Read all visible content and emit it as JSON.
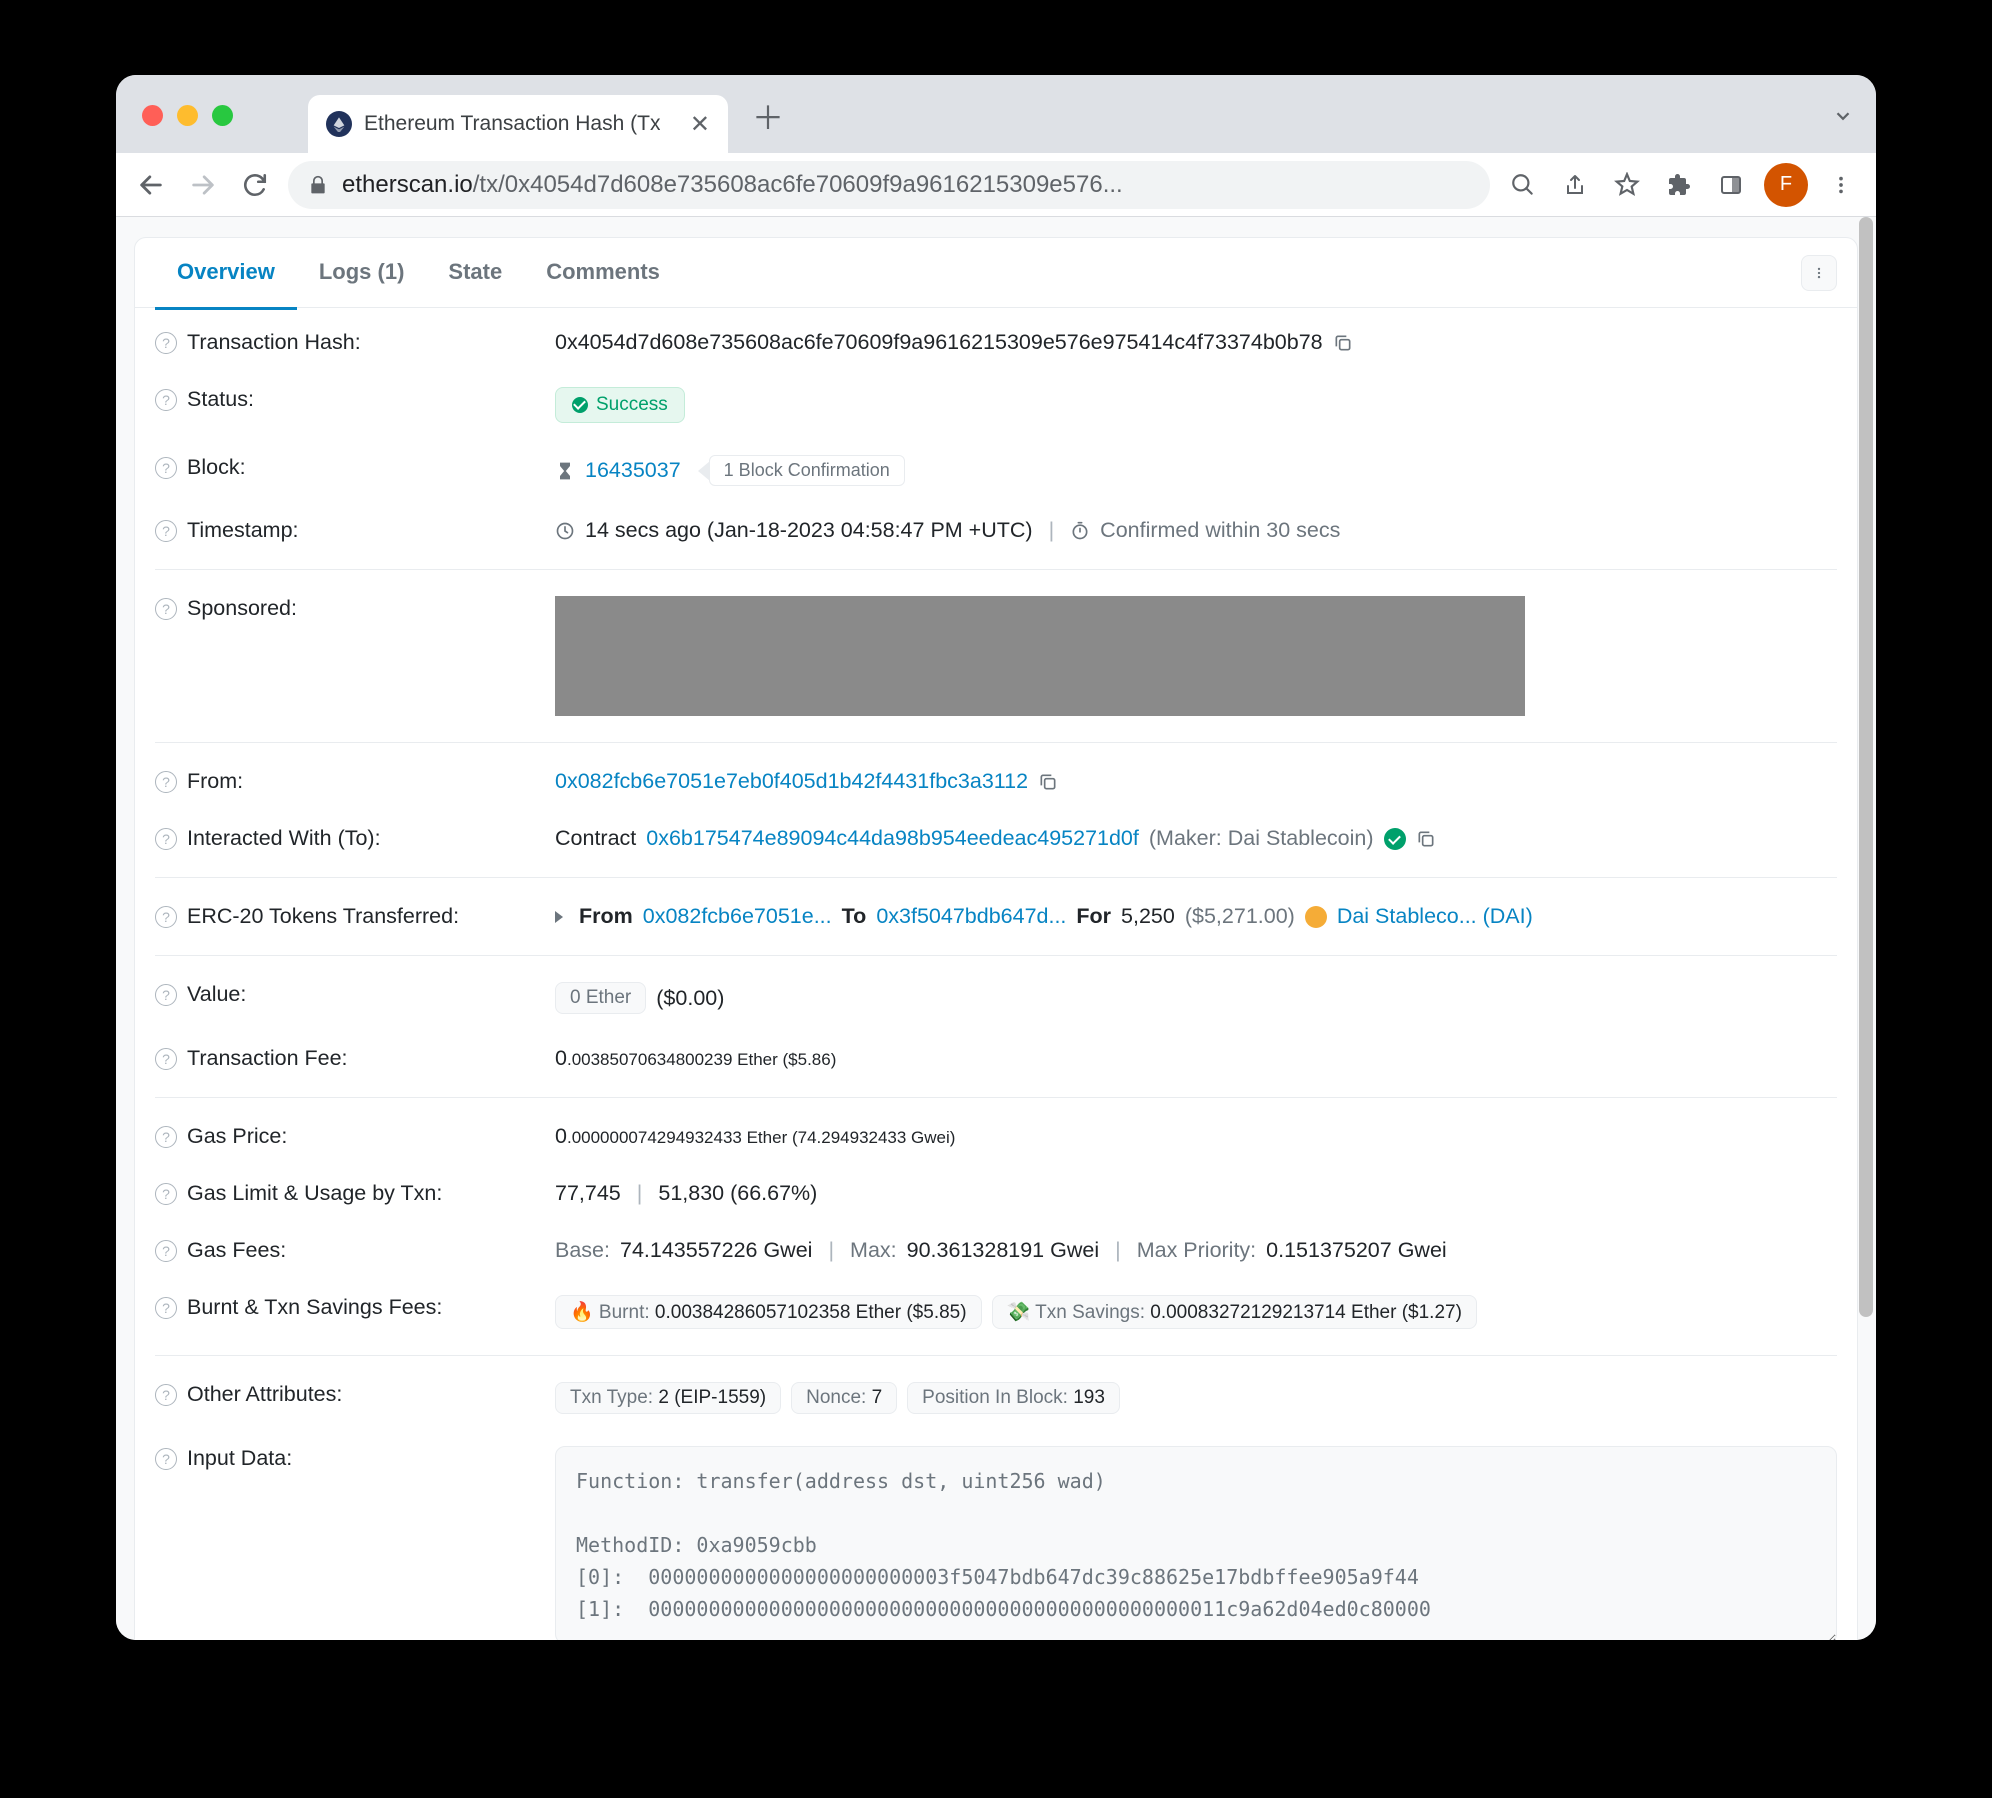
{
  "browser": {
    "tab_title": "Ethereum Transaction Hash (Tx",
    "url_domain": "etherscan.io",
    "url_path": "/tx/0x4054d7d608e735608ac6fe70609f9a9616215309e576...",
    "avatar_initial": "F"
  },
  "tabs": {
    "overview": "Overview",
    "logs": "Logs (1)",
    "state": "State",
    "comments": "Comments"
  },
  "labels": {
    "txhash": "Transaction Hash:",
    "status": "Status:",
    "block": "Block:",
    "timestamp": "Timestamp:",
    "sponsored": "Sponsored:",
    "from": "From:",
    "to": "Interacted With (To):",
    "erc20": "ERC-20 Tokens Transferred:",
    "value": "Value:",
    "txfee": "Transaction Fee:",
    "gasprice": "Gas Price:",
    "gaslimit": "Gas Limit & Usage by Txn:",
    "gasfees": "Gas Fees:",
    "burnt": "Burnt & Txn Savings Fees:",
    "otherattrs": "Other Attributes:",
    "inputdata": "Input Data:"
  },
  "values": {
    "txhash": "0x4054d7d608e735608ac6fe70609f9a9616215309e576e975414c4f73374b0b78",
    "status": "Success",
    "block_number": "16435037",
    "block_confirm": "1 Block Confirmation",
    "time_ago": "14 secs ago (Jan-18-2023 04:58:47 PM +UTC)",
    "time_confirmed": "Confirmed within 30 secs",
    "from_addr": "0x082fcb6e7051e7eb0f405d1b42f4431fbc3a3112",
    "to_prefix": "Contract",
    "to_addr": "0x6b175474e89094c44da98b954eedeac495271d0f",
    "to_label": "(Maker: Dai Stablecoin)",
    "erc20_from": "From",
    "erc20_from_addr": "0x082fcb6e7051e...",
    "erc20_to": "To",
    "erc20_to_addr": "0x3f5047bdb647d...",
    "erc20_for": "For",
    "erc20_amount": "5,250",
    "erc20_usd": "($5,271.00)",
    "erc20_token": "Dai Stableco... (DAI)",
    "value_pill": "0 Ether",
    "value_usd": "($0.00)",
    "txfee_int": "0",
    "txfee_dec": ".00385070634800239 Ether ($5.86)",
    "gasprice_int": "0",
    "gasprice_dec": ".000000074294932433 Ether (74.294932433 Gwei)",
    "gas_limit": "77,745",
    "gas_used": "51,830 (66.67%)",
    "gf_base_lbl": "Base:",
    "gf_base": "74.143557226 Gwei",
    "gf_max_lbl": "Max:",
    "gf_max": "90.361328191 Gwei",
    "gf_maxprio_lbl": "Max Priority:",
    "gf_maxprio": "0.151375207 Gwei",
    "burnt_label": "🔥 Burnt: ",
    "burnt_val": "0.00384286057102358 Ether ($5.85)",
    "savings_label": "💸 Txn Savings: ",
    "savings_val": "0.00083272129213714 Ether ($1.27)",
    "attr_type_lbl": "Txn Type:",
    "attr_type": "2 (EIP-1559)",
    "attr_nonce_lbl": "Nonce:",
    "attr_nonce": "7",
    "attr_pos_lbl": "Position In Block:",
    "attr_pos": "193",
    "input_data": "Function: transfer(address dst, uint256 wad)\n\nMethodID: 0xa9059cbb\n[0]:  0000000000000000000000003f5047bdb647dc39c88625e17bdbffee905a9f44\n[1]:  000000000000000000000000000000000000000000000011c9a62d04ed0c80000"
  }
}
